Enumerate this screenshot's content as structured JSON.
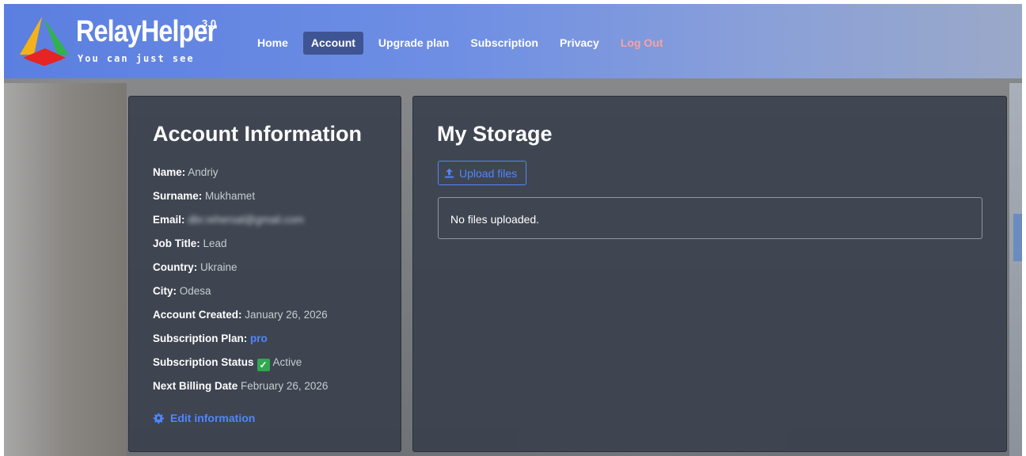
{
  "brand": {
    "name": "RelayHelper",
    "version": "3.0",
    "tagline": "You can just see"
  },
  "nav": {
    "items": [
      {
        "label": "Home"
      },
      {
        "label": "Account"
      },
      {
        "label": "Upgrade plan"
      },
      {
        "label": "Subscription"
      },
      {
        "label": "Privacy"
      },
      {
        "label": "Log Out"
      }
    ]
  },
  "account": {
    "title": "Account Information",
    "rows": [
      {
        "key": "Name",
        "sep": ":",
        "value": "Andriy"
      },
      {
        "key": "Surname",
        "sep": ":",
        "value": "Mukhamet"
      },
      {
        "key": "Email",
        "sep": ":",
        "value": "dbr.rehersal@gmail.com"
      },
      {
        "key": "Job Title",
        "sep": ":",
        "value": "Lead"
      },
      {
        "key": "Country",
        "sep": ":",
        "value": "Ukraine"
      },
      {
        "key": "City",
        "sep": ":",
        "value": "Odesa"
      },
      {
        "key": "Account Created",
        "sep": ":",
        "value": "January 26, 2026"
      },
      {
        "key": "Subscription Plan",
        "sep": ":",
        "value": "pro"
      },
      {
        "key": "Subscription Status",
        "sep": "",
        "value": "Active"
      },
      {
        "key": "Next Billing Date",
        "sep": "",
        "value": "February 26, 2026"
      }
    ],
    "edit_label": "Edit information"
  },
  "storage": {
    "title": "My Storage",
    "upload_label": "Upload files",
    "empty_message": "No files uploaded."
  },
  "colors": {
    "accent": "#4f86ff",
    "active_nav": "#3f5493",
    "logout": "#f7a3a3",
    "status_check": "#2fa84f"
  },
  "icons": {
    "logo": "tri-color-logo-icon",
    "edit": "gear-icon",
    "upload": "upload-icon",
    "status": "checkmark-icon"
  }
}
